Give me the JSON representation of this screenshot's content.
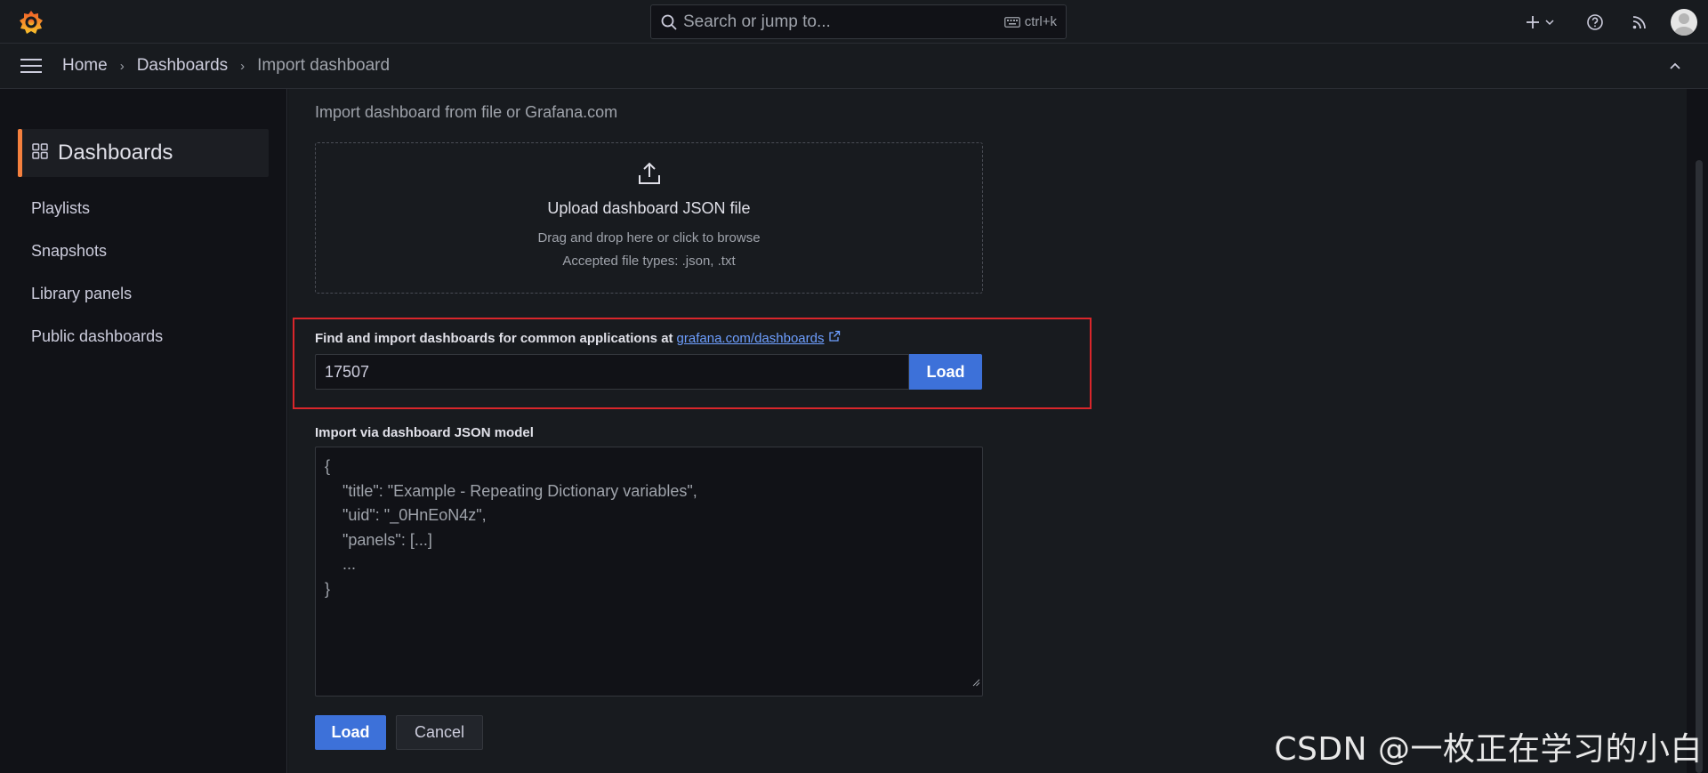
{
  "topbar": {
    "search_placeholder": "Search or jump to...",
    "search_shortcut": "ctrl+k"
  },
  "breadcrumb": {
    "items": [
      "Home",
      "Dashboards",
      "Import dashboard"
    ],
    "separator": "›"
  },
  "sidebar": {
    "section_title": "Dashboards",
    "items": [
      "Playlists",
      "Snapshots",
      "Library panels",
      "Public dashboards"
    ]
  },
  "main": {
    "subtitle": "Import dashboard from file or Grafana.com",
    "upload": {
      "title": "Upload dashboard JSON file",
      "hint": "Drag and drop here or click to browse",
      "types": "Accepted file types: .json, .txt"
    },
    "grafana_com": {
      "label": "Find and import dashboards for common applications at",
      "link_text": "grafana.com/dashboards",
      "input_value": "17507",
      "load_label": "Load"
    },
    "json_model": {
      "label": "Import via dashboard JSON model",
      "placeholder": "{\n    \"title\": \"Example - Repeating Dictionary variables\",\n    \"uid\": \"_0HnEoN4z\",\n    \"panels\": [...]\n    ...\n}"
    },
    "actions": {
      "load_label": "Load",
      "cancel_label": "Cancel"
    }
  },
  "watermark": "CSDN @一枚正在学习的小白",
  "colors": {
    "accent": "#f5803e",
    "primary_button": "#3d71d9",
    "link": "#6e9fff",
    "highlight_border": "#d9262b"
  }
}
